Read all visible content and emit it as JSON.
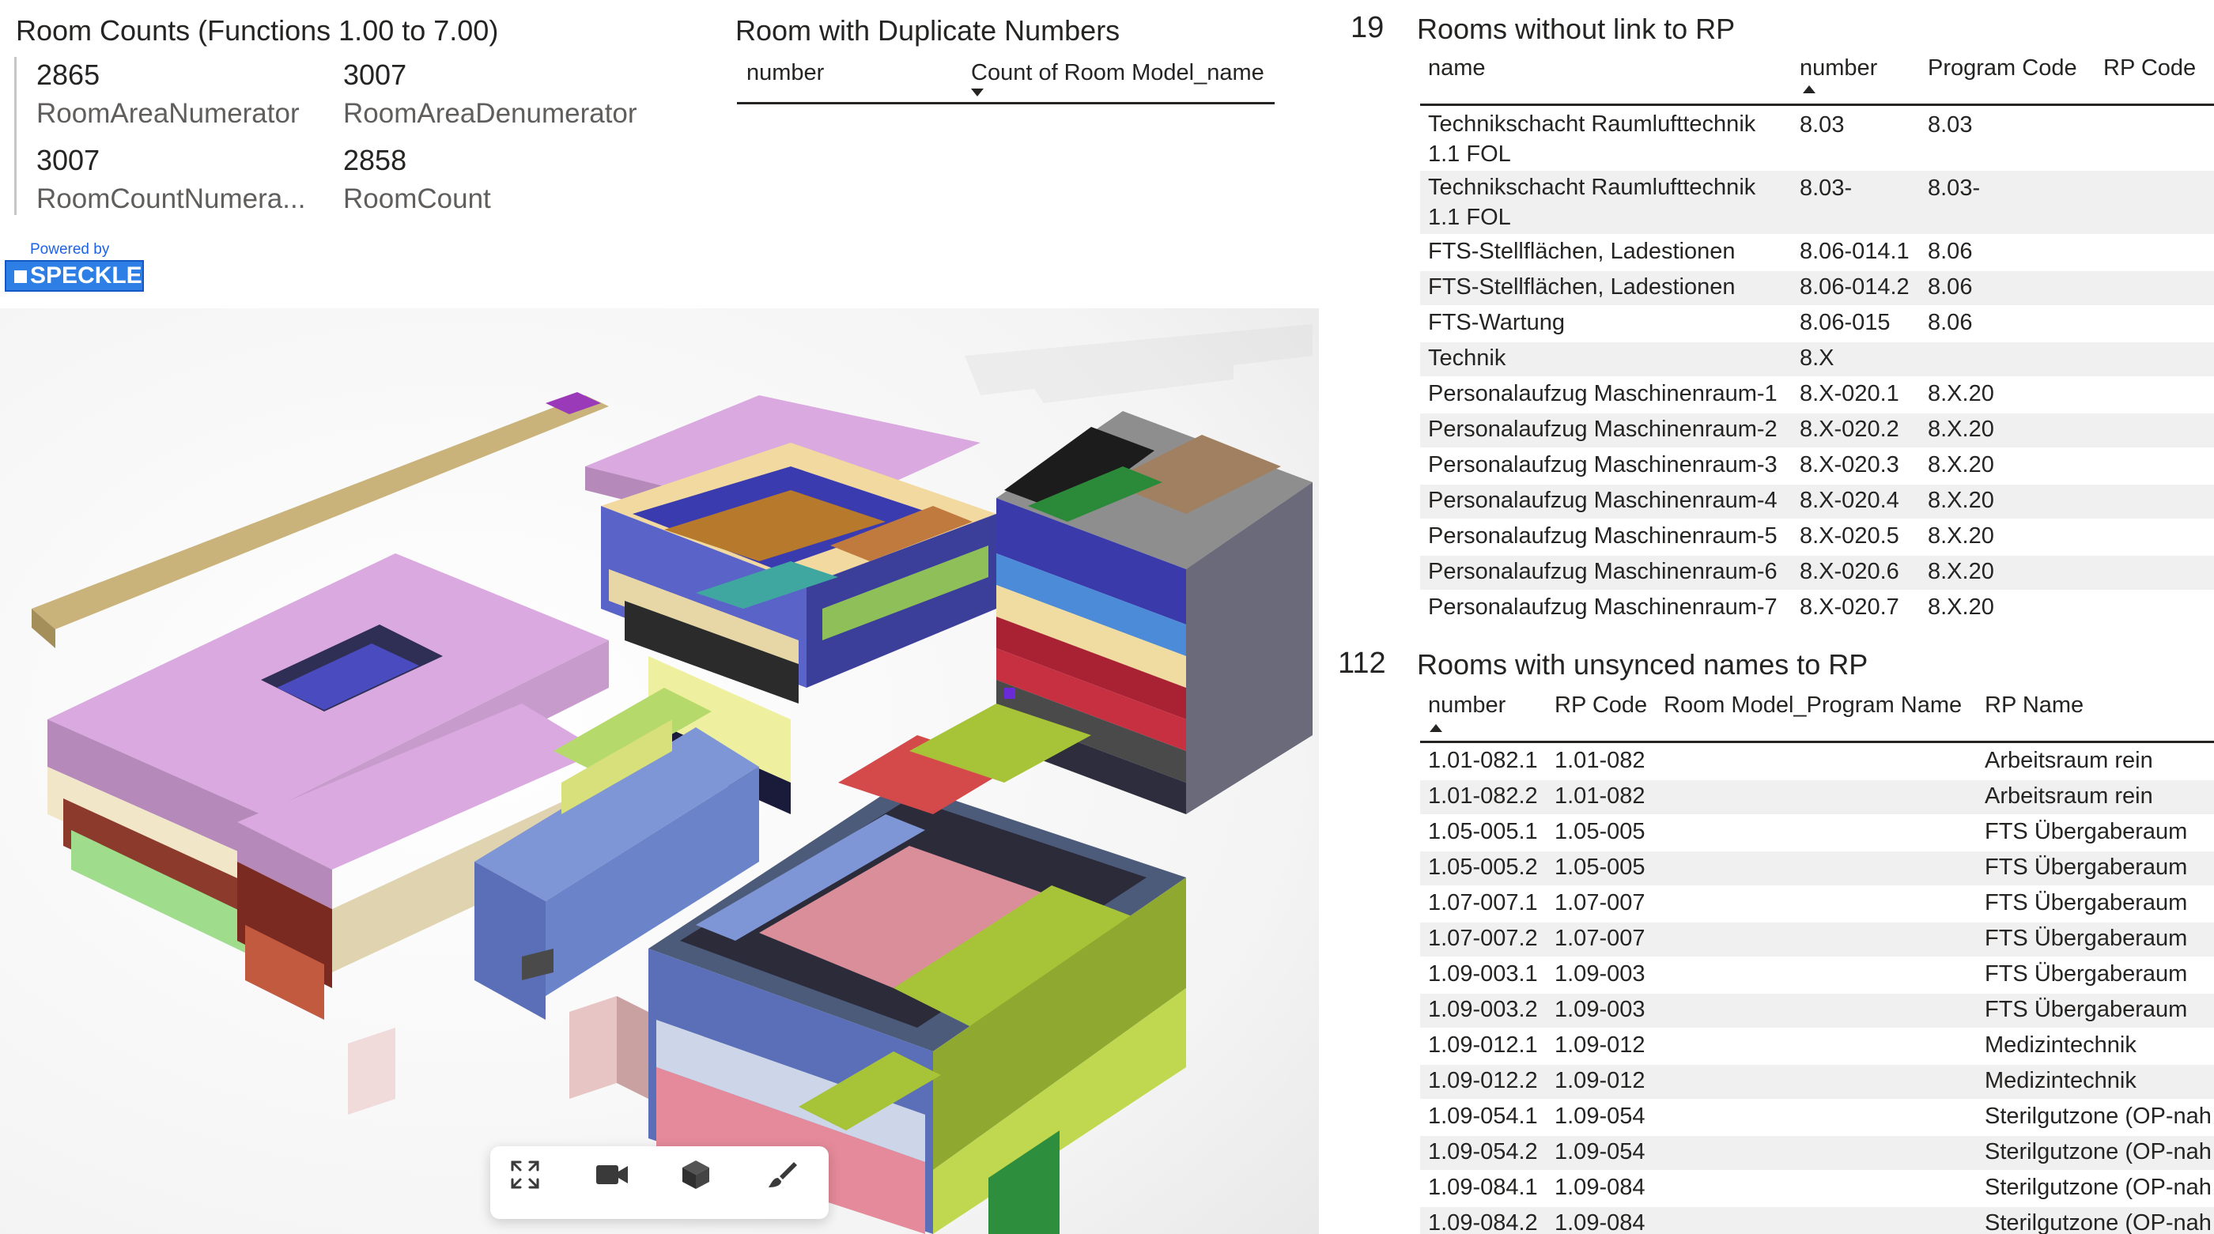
{
  "counts": {
    "title": "Room Counts (Functions 1.00 to 7.00)",
    "kpis": [
      {
        "value": "2865",
        "label": "RoomAreaNumerator"
      },
      {
        "value": "3007",
        "label": "RoomAreaDenumerator"
      },
      {
        "value": "3007",
        "label": "RoomCountNumera..."
      },
      {
        "value": "2858",
        "label": "RoomCount"
      }
    ]
  },
  "speckle": {
    "powered_by": "Powered by",
    "brand": "SPECKLE"
  },
  "duplicates": {
    "title": "Room with Duplicate Numbers",
    "columns": [
      "number",
      "Count of Room Model_name"
    ]
  },
  "viewer": {
    "toolbar": [
      {
        "icon": "fullscreen-icon"
      },
      {
        "icon": "video-camera-icon"
      },
      {
        "icon": "cube-icon"
      },
      {
        "icon": "paint-brush-icon"
      }
    ]
  },
  "no_link": {
    "count": "19",
    "title": "Rooms without link to RP",
    "columns": [
      "name",
      "number",
      "Program Code",
      "RP Code"
    ],
    "rows": [
      {
        "name": "Technikschacht Raumlufttechnik 1.1 FOL",
        "number": "8.03",
        "program_code": "8.03",
        "rp_code": ""
      },
      {
        "name": "Technikschacht Raumlufttechnik 1.1 FOL",
        "number": "8.03-",
        "program_code": "8.03-",
        "rp_code": ""
      },
      {
        "name": "FTS-Stellflächen, Ladestionen",
        "number": "8.06-014.1",
        "program_code": "8.06",
        "rp_code": ""
      },
      {
        "name": "FTS-Stellflächen, Ladestionen",
        "number": "8.06-014.2",
        "program_code": "8.06",
        "rp_code": ""
      },
      {
        "name": "FTS-Wartung",
        "number": "8.06-015",
        "program_code": "8.06",
        "rp_code": ""
      },
      {
        "name": "Technik",
        "number": "8.X",
        "program_code": "",
        "rp_code": ""
      },
      {
        "name": "Personalaufzug Maschinenraum-1",
        "number": "8.X-020.1",
        "program_code": "8.X.20",
        "rp_code": ""
      },
      {
        "name": "Personalaufzug Maschinenraum-2",
        "number": "8.X-020.2",
        "program_code": "8.X.20",
        "rp_code": ""
      },
      {
        "name": "Personalaufzug Maschinenraum-3",
        "number": "8.X-020.3",
        "program_code": "8.X.20",
        "rp_code": ""
      },
      {
        "name": "Personalaufzug Maschinenraum-4",
        "number": "8.X-020.4",
        "program_code": "8.X.20",
        "rp_code": ""
      },
      {
        "name": "Personalaufzug Maschinenraum-5",
        "number": "8.X-020.5",
        "program_code": "8.X.20",
        "rp_code": ""
      },
      {
        "name": "Personalaufzug Maschinenraum-6",
        "number": "8.X-020.6",
        "program_code": "8.X.20",
        "rp_code": ""
      },
      {
        "name": "Personalaufzug Maschinenraum-7",
        "number": "8.X-020.7",
        "program_code": "8.X.20",
        "rp_code": ""
      }
    ]
  },
  "unsynced": {
    "count": "112",
    "title": "Rooms with unsynced names to RP",
    "columns": [
      "number",
      "RP Code",
      "Room Model_Program Name",
      "RP Name"
    ],
    "rows": [
      {
        "number": "1.01-082.1",
        "rp_code": "1.01-082",
        "program_name": "",
        "rp_name": "Arbeitsraum rein"
      },
      {
        "number": "1.01-082.2",
        "rp_code": "1.01-082",
        "program_name": "",
        "rp_name": "Arbeitsraum rein"
      },
      {
        "number": "1.05-005.1",
        "rp_code": "1.05-005",
        "program_name": "",
        "rp_name": "FTS Übergaberaum"
      },
      {
        "number": "1.05-005.2",
        "rp_code": "1.05-005",
        "program_name": "",
        "rp_name": "FTS Übergaberaum"
      },
      {
        "number": "1.07-007.1",
        "rp_code": "1.07-007",
        "program_name": "",
        "rp_name": "FTS Übergaberaum"
      },
      {
        "number": "1.07-007.2",
        "rp_code": "1.07-007",
        "program_name": "",
        "rp_name": "FTS Übergaberaum"
      },
      {
        "number": "1.09-003.1",
        "rp_code": "1.09-003",
        "program_name": "",
        "rp_name": "FTS Übergaberaum"
      },
      {
        "number": "1.09-003.2",
        "rp_code": "1.09-003",
        "program_name": "",
        "rp_name": "FTS Übergaberaum"
      },
      {
        "number": "1.09-012.1",
        "rp_code": "1.09-012",
        "program_name": "",
        "rp_name": "Medizintechnik"
      },
      {
        "number": "1.09-012.2",
        "rp_code": "1.09-012",
        "program_name": "",
        "rp_name": "Medizintechnik"
      },
      {
        "number": "1.09-054.1",
        "rp_code": "1.09-054",
        "program_name": "",
        "rp_name": "Sterilgutzone (OP-nah"
      },
      {
        "number": "1.09-054.2",
        "rp_code": "1.09-054",
        "program_name": "",
        "rp_name": "Sterilgutzone (OP-nah"
      },
      {
        "number": "1.09-084.1",
        "rp_code": "1.09-084",
        "program_name": "",
        "rp_name": "Sterilgutzone (OP-nah"
      },
      {
        "number": "1.09-084.2",
        "rp_code": "1.09-084",
        "program_name": "",
        "rp_name": "Sterilgutzone (OP-nah"
      }
    ]
  }
}
